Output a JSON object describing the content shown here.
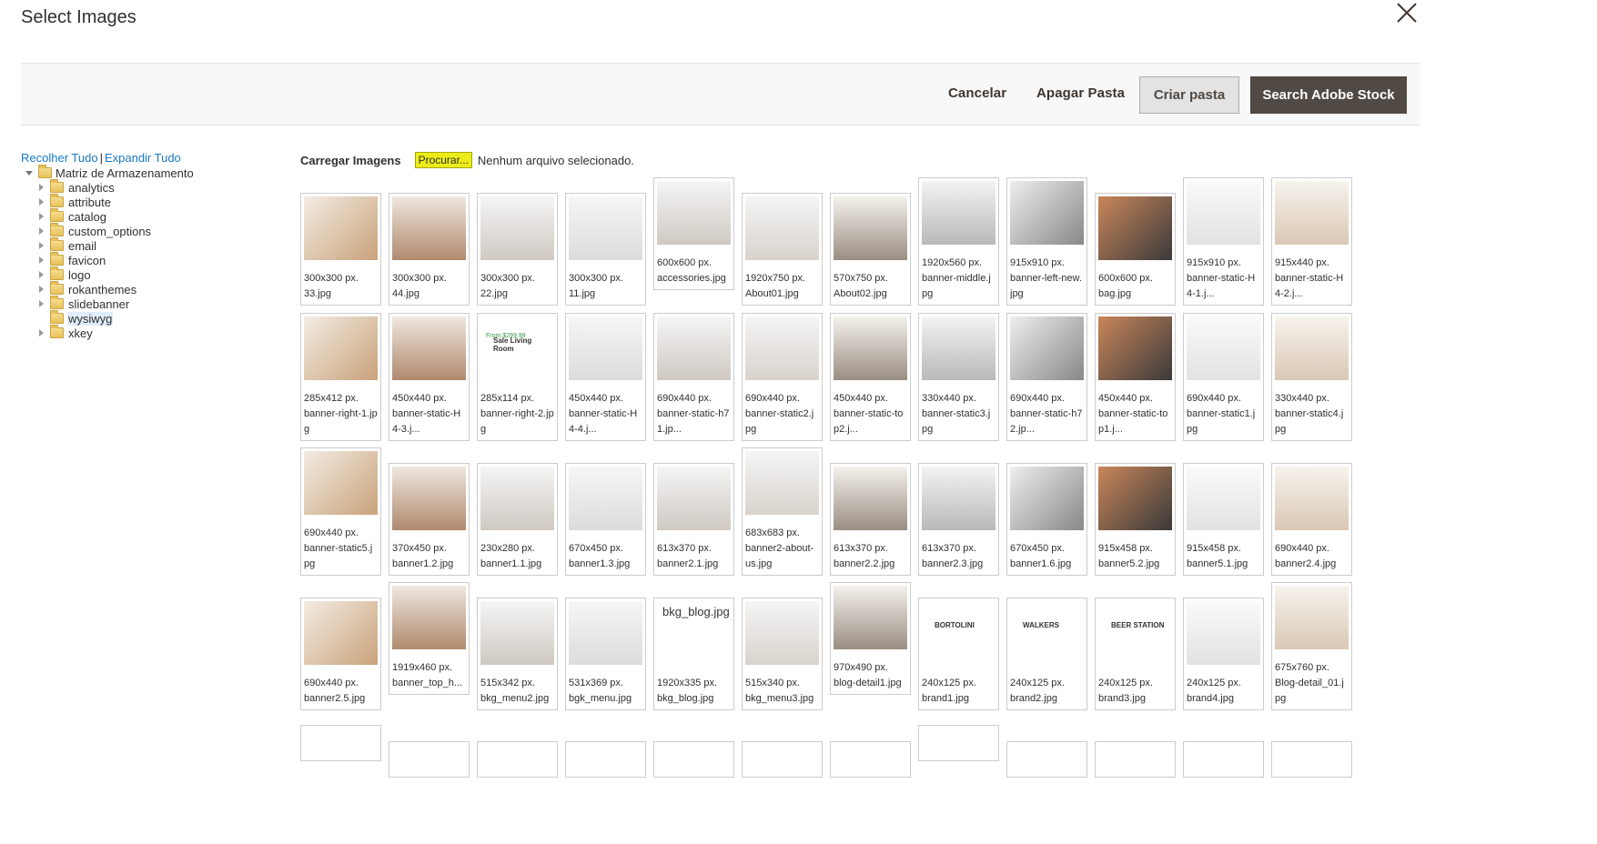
{
  "modal": {
    "title": "Select Images",
    "close_icon": "close-icon"
  },
  "toolbar": {
    "cancel_label": "Cancelar",
    "delete_folder_label": "Apagar Pasta",
    "create_folder_label": "Criar pasta",
    "adobe_stock_label": "Search Adobe Stock"
  },
  "tree": {
    "collapse_all": "Recolher Tudo",
    "separator": "|",
    "expand_all": "Expandir Tudo",
    "root": "Matriz de Armazenamento",
    "folders": [
      {
        "label": "analytics"
      },
      {
        "label": "attribute"
      },
      {
        "label": "catalog"
      },
      {
        "label": "custom_options"
      },
      {
        "label": "email"
      },
      {
        "label": "favicon"
      },
      {
        "label": "logo"
      },
      {
        "label": "rokanthemes"
      },
      {
        "label": "slidebanner"
      },
      {
        "label": "wysiwyg"
      },
      {
        "label": "xkey"
      }
    ],
    "selected": "wysiwyg"
  },
  "upload": {
    "label": "Carregar Imagens",
    "browse_label": "Procurar...",
    "no_file": "Nenhum arquivo selecionado."
  },
  "images": [
    {
      "dims": "300x300 px.",
      "name": "33.jpg"
    },
    {
      "dims": "300x300 px.",
      "name": "44.jpg"
    },
    {
      "dims": "300x300 px.",
      "name": "22.jpg"
    },
    {
      "dims": "300x300 px.",
      "name": "11.jpg"
    },
    {
      "dims": "600x600 px.",
      "name": "accessories.jpg"
    },
    {
      "dims": "1920x750 px.",
      "name": "About01.jpg"
    },
    {
      "dims": "570x750 px.",
      "name": "About02.jpg"
    },
    {
      "dims": "1920x560 px.",
      "name": "banner-middle.jpg"
    },
    {
      "dims": "915x910 px.",
      "name": "banner-left-new.jpg"
    },
    {
      "dims": "600x600 px.",
      "name": "bag.jpg"
    },
    {
      "dims": "915x910 px.",
      "name": "banner-static-H4-1.j..."
    },
    {
      "dims": "915x440 px.",
      "name": "banner-static-H4-2.j..."
    },
    {
      "dims": "285x412 px.",
      "name": "banner-right-1.jpg"
    },
    {
      "dims": "450x440 px.",
      "name": "banner-static-H4-3.j..."
    },
    {
      "dims": "285x114 px.",
      "name": "banner-right-2.jpg",
      "thumb_text": "Sale Living Room",
      "thumb_price": "From $299.99"
    },
    {
      "dims": "450x440 px.",
      "name": "banner-static-H4-4.j..."
    },
    {
      "dims": "690x440 px.",
      "name": "banner-static-h71.jp..."
    },
    {
      "dims": "690x440 px.",
      "name": "banner-static2.jpg"
    },
    {
      "dims": "450x440 px.",
      "name": "banner-static-top2.j..."
    },
    {
      "dims": "330x440 px.",
      "name": "banner-static3.jpg"
    },
    {
      "dims": "690x440 px.",
      "name": "banner-static-h72.jp..."
    },
    {
      "dims": "450x440 px.",
      "name": "banner-static-top1.j..."
    },
    {
      "dims": "690x440 px.",
      "name": "banner-static1.jpg"
    },
    {
      "dims": "330x440 px.",
      "name": "banner-static4.jpg"
    },
    {
      "dims": "690x440 px.",
      "name": "banner-static5.jpg"
    },
    {
      "dims": "370x450 px.",
      "name": "banner1.2.jpg"
    },
    {
      "dims": "230x280 px.",
      "name": "banner1.1.jpg"
    },
    {
      "dims": "670x450 px.",
      "name": "banner1.3.jpg"
    },
    {
      "dims": "613x370 px.",
      "name": "banner2.1.jpg"
    },
    {
      "dims": "683x683 px.",
      "name": "banner2-about-us.jpg"
    },
    {
      "dims": "613x370 px.",
      "name": "banner2.2.jpg"
    },
    {
      "dims": "613x370 px.",
      "name": "banner2.3.jpg"
    },
    {
      "dims": "670x450 px.",
      "name": "banner1.6.jpg"
    },
    {
      "dims": "915x458 px.",
      "name": "banner5.2.jpg"
    },
    {
      "dims": "915x458 px.",
      "name": "banner5.1.jpg"
    },
    {
      "dims": "690x440 px.",
      "name": "banner2.4.jpg"
    },
    {
      "dims": "690x440 px.",
      "name": "banner2.5.jpg"
    },
    {
      "dims": "1919x460 px.",
      "name": "banner_top_h..."
    },
    {
      "dims": "515x342 px.",
      "name": "bkg_menu2.jpg"
    },
    {
      "dims": "531x369 px.",
      "name": "bgk_menu.jpg"
    },
    {
      "dims": "1920x335 px.",
      "name": "bkg_blog.jpg",
      "thumb_text": "bkg_blog.jpg"
    },
    {
      "dims": "515x340 px.",
      "name": "bkg_menu3.jpg"
    },
    {
      "dims": "970x490 px.",
      "name": "blog-detail1.jpg"
    },
    {
      "dims": "240x125 px.",
      "name": "brand1.jpg",
      "thumb_text": "BORTOLINI"
    },
    {
      "dims": "240x125 px.",
      "name": "brand2.jpg",
      "thumb_text": "WALKERS"
    },
    {
      "dims": "240x125 px.",
      "name": "brand3.jpg",
      "thumb_text": "BEER STATION"
    },
    {
      "dims": "240x125 px.",
      "name": "brand4.jpg"
    },
    {
      "dims": "675x760 px.",
      "name": "Blog-detail_01.jpg"
    }
  ],
  "colors": {
    "link": "#1979c3",
    "primary_button": "#514943",
    "browse_button": "#ecec18",
    "selected_folder": "#e0ecf7"
  }
}
